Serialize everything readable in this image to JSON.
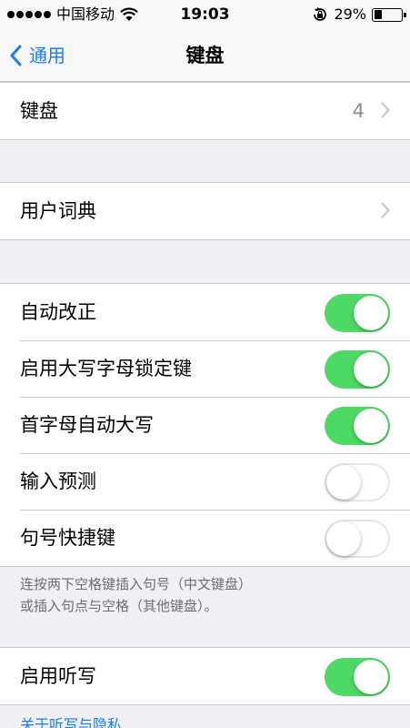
{
  "status_bar": {
    "carrier": "中国移动",
    "time": "19:03",
    "battery_percent": "29%",
    "battery_level": 0.29
  },
  "nav": {
    "back_label": "通用",
    "title": "键盘"
  },
  "group_keyboards": {
    "label": "键盘",
    "value": "4"
  },
  "group_dictionary": {
    "label": "用户词典"
  },
  "group_toggles": {
    "items": [
      {
        "label": "自动改正",
        "state": "on"
      },
      {
        "label": "启用大写字母锁定键",
        "state": "on"
      },
      {
        "label": "首字母自动大写",
        "state": "on"
      },
      {
        "label": "输入预测",
        "state": "off"
      },
      {
        "label": "句号快捷键",
        "state": "off"
      }
    ],
    "note_line1": "连按两下空格键插入句号（中文键盘）",
    "note_line2": "或插入句点与空格（其他键盘）。"
  },
  "group_dictation": {
    "label": "启用听写",
    "state": "on",
    "link": "关于听写与隐私"
  },
  "colors": {
    "accent": "#1a7bf0",
    "toggle_on": "#4cd964",
    "background": "#efeff4"
  }
}
